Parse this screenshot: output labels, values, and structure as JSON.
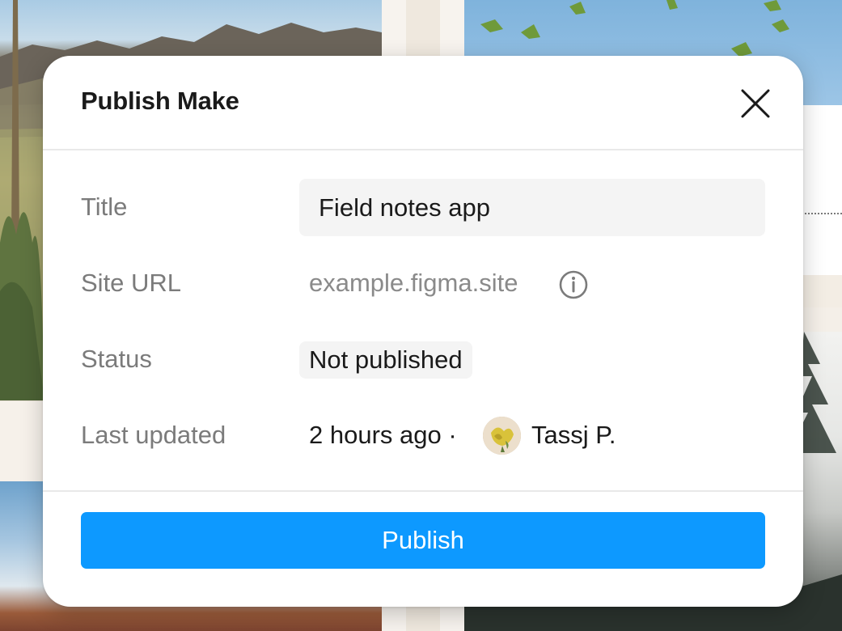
{
  "dialog": {
    "title": "Publish Make",
    "close_icon": "close-icon",
    "fields": {
      "title_label": "Title",
      "title_value": "Field notes app",
      "site_url_label": "Site URL",
      "site_url_value": "example.figma.site",
      "info_icon": "info-icon",
      "status_label": "Status",
      "status_value": "Not published",
      "last_updated_label": "Last updated",
      "last_updated_time": "2 hours ago ·",
      "last_updated_user": "Tassj P."
    },
    "publish_button": "Publish"
  },
  "colors": {
    "accent": "#0d99ff",
    "label": "#7b7b7b",
    "text": "#1a1a1a",
    "field_bg": "#f4f4f4"
  }
}
